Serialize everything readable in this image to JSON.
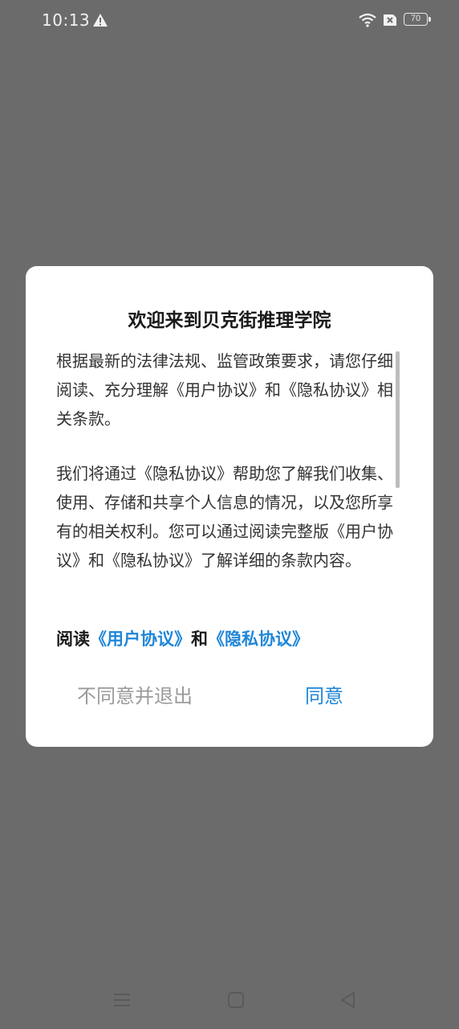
{
  "status_bar": {
    "time": "10:13",
    "battery_level": "70",
    "icons": [
      "warning-icon",
      "wifi-icon",
      "sim-off-icon",
      "battery-icon"
    ]
  },
  "dialog": {
    "title": "欢迎来到贝克街推理学院",
    "paragraph1": "根据最新的法律法规、监管政策要求，请您仔细阅读、充分理解《用户协议》和《隐私协议》相关条款。",
    "paragraph2": "我们将通过《隐私协议》帮助您了解我们收集、使用、存储和共享个人信息的情况，以及您所享有的相关权利。您可以通过阅读完整版《用户协议》和《隐私协议》了解详细的条款内容。",
    "read_prefix": "阅读",
    "user_agreement_link": "《用户协议》",
    "read_and": "和",
    "privacy_agreement_link": "《隐私协议》",
    "decline_label": "不同意并退出",
    "agree_label": "同意"
  },
  "colors": {
    "overlay": "#6b6b6b",
    "link": "#1f86d8",
    "decline": "#9a9a9a"
  },
  "nav_bar": {
    "icons": [
      "menu-icon",
      "home-icon",
      "back-icon"
    ]
  }
}
